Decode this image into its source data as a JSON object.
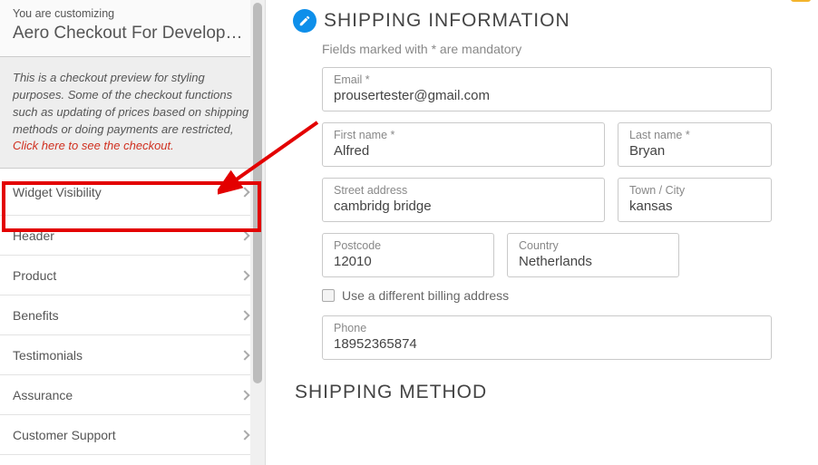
{
  "sidebar": {
    "you_are": "You are customizing",
    "page_title": "Aero Checkout For Develop…",
    "note_body": "This is a checkout preview for styling purposes. Some of the checkout functions such as updating of prices based on shipping methods or doing payments are restricted, ",
    "note_link": "Click here to see the checkout.",
    "items": [
      {
        "label": "Widget Visibility"
      },
      {
        "label": "Header"
      },
      {
        "label": "Product"
      },
      {
        "label": "Benefits"
      },
      {
        "label": "Testimonials"
      },
      {
        "label": "Assurance"
      },
      {
        "label": "Customer Support"
      }
    ]
  },
  "preview": {
    "section_title": "SHIPPING INFORMATION",
    "mandatory_note": "Fields marked with * are mandatory",
    "email": {
      "label": "Email *",
      "value": "prousertester@gmail.com"
    },
    "first_name": {
      "label": "First name *",
      "value": "Alfred"
    },
    "last_name": {
      "label": "Last name *",
      "value": "Bryan"
    },
    "street": {
      "label": "Street address",
      "value": "cambridg bridge"
    },
    "town": {
      "label": "Town / City",
      "value": "kansas"
    },
    "postcode": {
      "label": "Postcode",
      "value": "12010"
    },
    "country": {
      "label": "Country",
      "value": "Netherlands"
    },
    "diff_billing": "Use a different billing address",
    "phone": {
      "label": "Phone",
      "value": "18952365874"
    },
    "method_title": "SHIPPING METHOD"
  }
}
